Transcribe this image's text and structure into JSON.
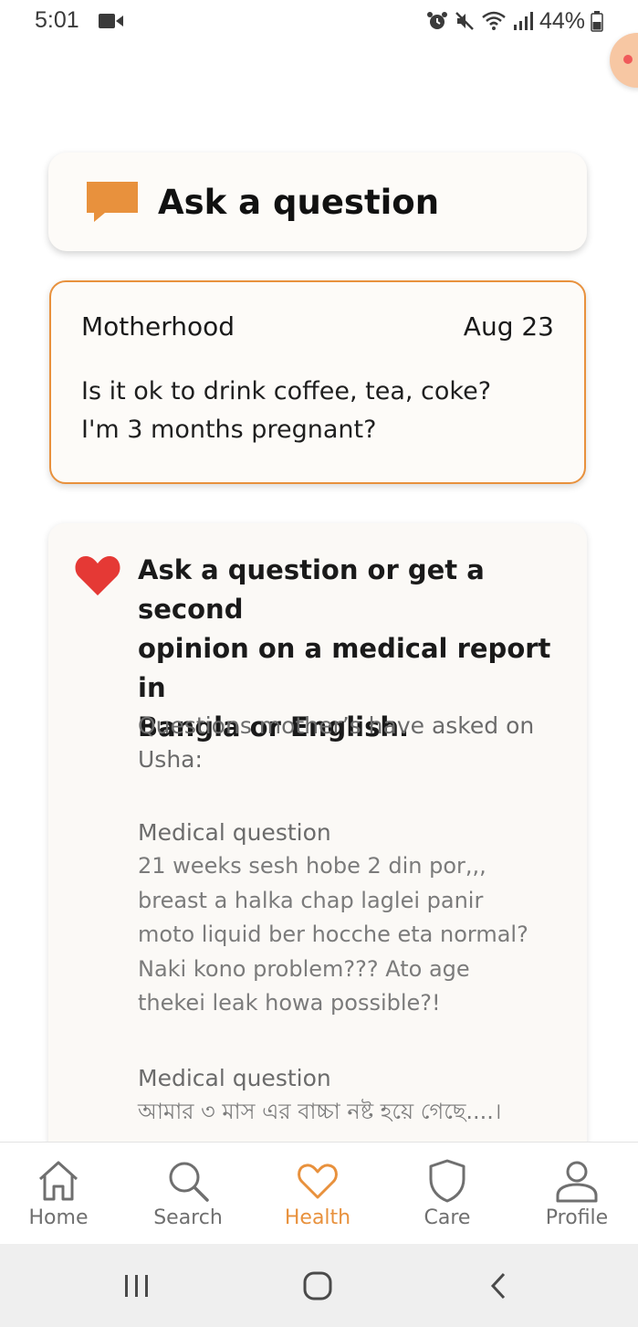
{
  "status_bar": {
    "time": "5:01",
    "battery": "44%",
    "icons": [
      "video-camera-icon",
      "alarm-icon",
      "mute-icon",
      "wifi-icon",
      "signal-icon",
      "battery-icon"
    ]
  },
  "ask_card": {
    "label": "Ask a question",
    "icon": "chat-bubble-icon"
  },
  "question_card": {
    "category": "Motherhood",
    "date": "Aug 23",
    "text_line1": "Is it ok to drink coffee, tea, coke?",
    "text_line2": "I'm 3 months pregnant?"
  },
  "info_card": {
    "title_line1": "Ask a question or get a second",
    "title_line2": "opinion on a medical report in",
    "title_line3": "Bangla or English.",
    "sub_line1": "Questions mother’s have asked on",
    "sub_line2": "Usha:",
    "items": [
      {
        "label": "Medical question",
        "lines": [
          "21 weeks sesh hobe 2 din por,,,",
          "breast a halka chap laglei panir",
          "moto liquid ber hocche eta normal?",
          "Naki kono problem??? Ato age",
          "thekei leak howa possible?!"
        ]
      },
      {
        "label": "Medical question",
        "lines": [
          "আমার ৩ মাস এর বাচ্চা নষ্ট হয়ে গেছে....।"
        ]
      }
    ]
  },
  "bottom_nav": {
    "items": [
      {
        "label": "Home",
        "icon": "home-icon"
      },
      {
        "label": "Search",
        "icon": "search-icon"
      },
      {
        "label": "Health",
        "icon": "heart-icon",
        "active": true
      },
      {
        "label": "Care",
        "icon": "shield-icon"
      },
      {
        "label": "Profile",
        "icon": "person-icon"
      }
    ]
  },
  "colors": {
    "accent": "#e8913d",
    "heart": "#e53935",
    "text_primary": "#1a1a1a",
    "text_muted": "#6b6b6b"
  }
}
